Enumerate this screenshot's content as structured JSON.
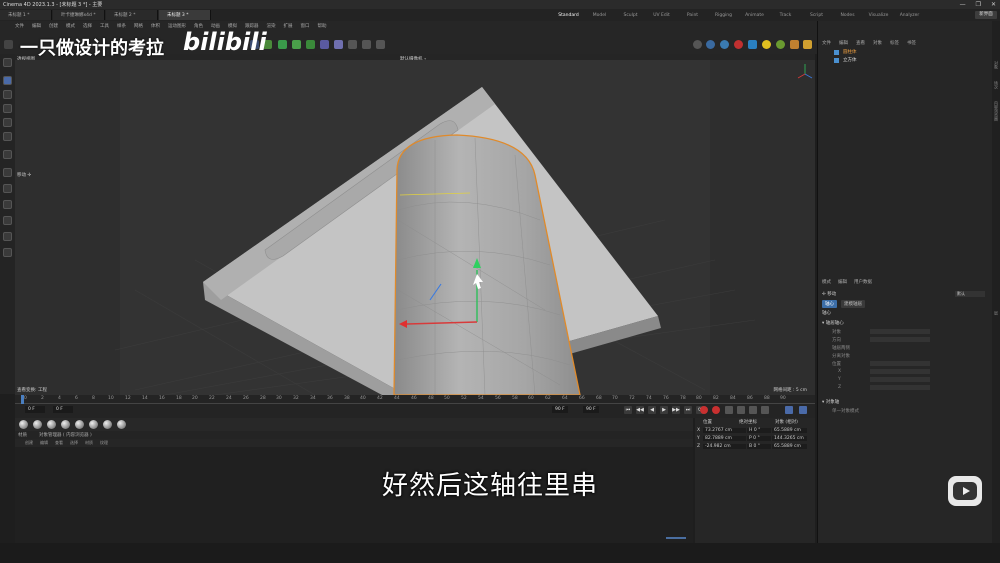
{
  "window": {
    "title": "Cinema 4D 2023.1.3 - [未标题 3 *] - 主要",
    "controls": [
      "—",
      "❐",
      "✕"
    ]
  },
  "doc_tabs": [
    "未标题 1 *",
    "叶卡捷琳娜x4d *",
    "未标题 2 *",
    "未标题 3 *"
  ],
  "layouts": [
    "Standard",
    "Model",
    "Sculpt",
    "UV Edit",
    "Paint",
    "Rigging",
    "Animate",
    "Track",
    "Script",
    "Nodes",
    "Visualize",
    "Analyzer"
  ],
  "new_ui_button": "新界面",
  "menu": [
    "文件",
    "编辑",
    "创建",
    "模式",
    "选择",
    "工具",
    "样条",
    "网格",
    "体积",
    "运动图形",
    "角色",
    "动画",
    "模拟",
    "跟踪器",
    "渲染",
    "扩展",
    "窗口",
    "帮助"
  ],
  "watermark": "一只做设计的考拉",
  "bili_logo": "bilibili",
  "viewport": {
    "title": "透视视图",
    "camera": "默认摄像机 ∘",
    "tool_label": "移动 ✢",
    "view_info": "查看变换: 工程",
    "grid_spacing": "网格间距 : 5 cm"
  },
  "timeline": {
    "ticks": [
      "0",
      "2",
      "4",
      "6",
      "8",
      "10",
      "12",
      "14",
      "16",
      "18",
      "20",
      "22",
      "24",
      "26",
      "28",
      "30",
      "32",
      "34",
      "36",
      "38",
      "40",
      "42",
      "44",
      "46",
      "48",
      "50",
      "52",
      "54",
      "56",
      "58",
      "60",
      "62",
      "64",
      "66",
      "68",
      "70",
      "72",
      "74",
      "76",
      "78",
      "80",
      "82",
      "84",
      "86",
      "88",
      "90"
    ],
    "current_frame": "0 F",
    "start_frame": "0 F",
    "end_frame": "90 F",
    "end_frame2": "90 F"
  },
  "transport": [
    "⏮",
    "◀◀",
    "◀",
    "▶",
    "▶▶",
    "⏭",
    "⟳"
  ],
  "material": {
    "tabs": [
      "材质",
      "对象管理器  ( 内容浏览器 )"
    ],
    "menu": [
      "创建",
      "编辑",
      "查看",
      "选择",
      "材质",
      "纹理"
    ]
  },
  "coords": {
    "header": [
      "位置",
      "尺寸",
      "旋转"
    ],
    "mode1": "绝对坐标",
    "mode2": "对象 (相对)",
    "rows": [
      {
        "axis": "X",
        "pos": "73.2767 cm",
        "rot": "H 0 °",
        "size": "65.5889 cm"
      },
      {
        "axis": "Y",
        "pos": "82.7889 cm",
        "rot": "P 0 °",
        "size": "144.3265 cm"
      },
      {
        "axis": "Z",
        "pos": "-24.982 cm",
        "rot": "B 0 °",
        "size": "65.5889 cm"
      }
    ]
  },
  "object_manager": {
    "tabs": [
      "文件",
      "编辑",
      "查看",
      "对象",
      "标签",
      "书签"
    ],
    "objects": [
      {
        "name": "圆柱体"
      },
      {
        "name": "立方体"
      }
    ]
  },
  "right_side_tabs": [
    "对象",
    "场次",
    "内容浏览器",
    "层"
  ],
  "attributes": {
    "tabs": [
      "模式",
      "编辑",
      "用户数据"
    ],
    "tool": "✢ 移动",
    "mode_select": "默认",
    "buttons": [
      "轴心",
      "建模轴居"
    ],
    "section1": "轴心",
    "subsection": "▾ 轴居轴心",
    "rows": [
      "对象",
      "方向",
      "轴居两侧",
      "分离对象",
      "位置"
    ],
    "axis_labels": [
      "X",
      "Y",
      "Z"
    ],
    "section2": "▾ 对象轴",
    "sub2": "单一对象模式"
  },
  "subtitle": "好然后这轴往里串"
}
